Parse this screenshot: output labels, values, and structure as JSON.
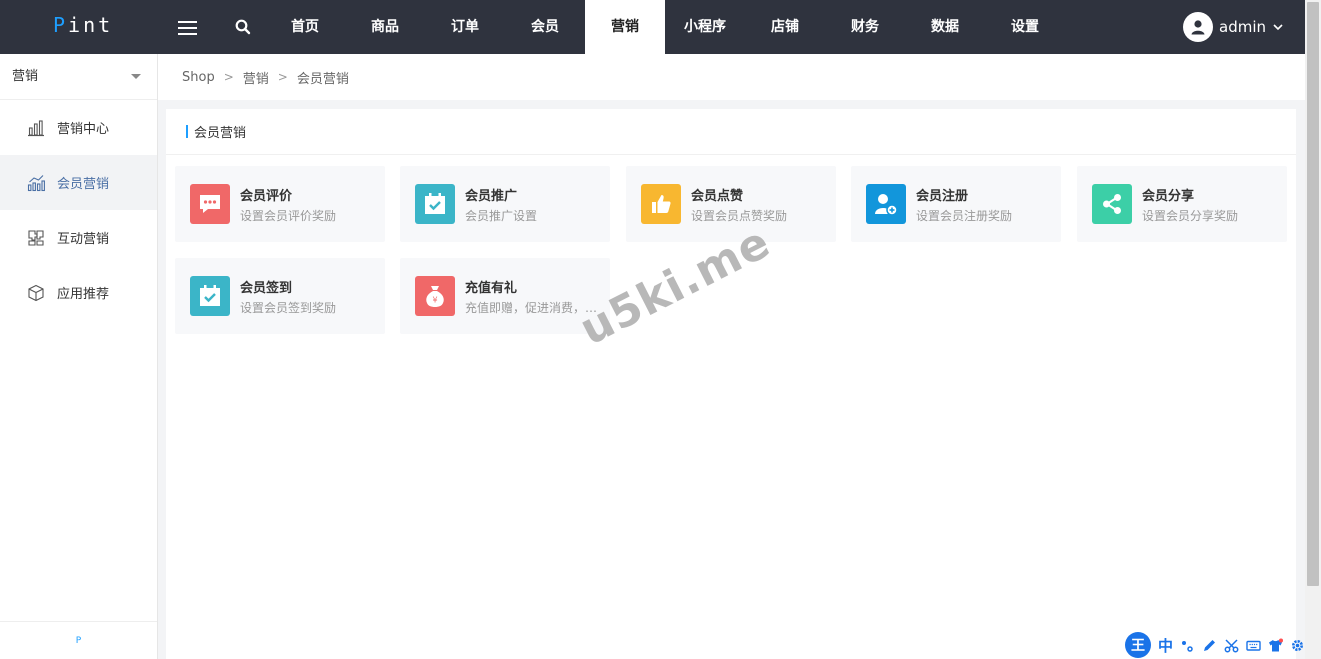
{
  "header": {
    "logo_prefix": "P",
    "logo_rest": "int",
    "nav": [
      {
        "label": "首页"
      },
      {
        "label": "商品"
      },
      {
        "label": "订单"
      },
      {
        "label": "会员"
      },
      {
        "label": "营销"
      },
      {
        "label": "小程序"
      },
      {
        "label": "店铺"
      },
      {
        "label": "财务"
      },
      {
        "label": "数据"
      },
      {
        "label": "设置"
      }
    ],
    "active_nav": "营销",
    "user_name": "admin"
  },
  "sidebar": {
    "section": "营销",
    "items": [
      {
        "label": "营销中心",
        "icon": "bar-chart-icon"
      },
      {
        "label": "会员营销",
        "icon": "line-chart-icon"
      },
      {
        "label": "互动营销",
        "icon": "puzzle-icon"
      },
      {
        "label": "应用推荐",
        "icon": "cube-icon"
      }
    ],
    "active_item": "会员营销",
    "footer": "P"
  },
  "breadcrumb": [
    "Shop",
    "营销",
    "会员营销"
  ],
  "panel": {
    "title": "会员营销",
    "tiles": [
      {
        "title": "会员评价",
        "desc": "设置会员评价奖励",
        "icon": "comment-icon",
        "color": "#f06868"
      },
      {
        "title": "会员推广",
        "desc": "会员推广设置",
        "icon": "calendar-check-icon",
        "color": "#3bb5c8"
      },
      {
        "title": "会员点赞",
        "desc": "设置会员点赞奖励",
        "icon": "thumbs-up-icon",
        "color": "#f8b730"
      },
      {
        "title": "会员注册",
        "desc": "设置会员注册奖励",
        "icon": "user-add-icon",
        "color": "#1296db"
      },
      {
        "title": "会员分享",
        "desc": "设置会员分享奖励",
        "icon": "share-icon",
        "color": "#3ccfa7"
      },
      {
        "title": "会员签到",
        "desc": "设置会员签到奖励",
        "icon": "calendar-check-icon",
        "color": "#3bb5c8"
      },
      {
        "title": "充值有礼",
        "desc": "充值即赠，促进消费，提升会员粘性",
        "icon": "money-bag-icon",
        "color": "#f06868"
      }
    ]
  },
  "watermark": "u5ki.me",
  "ime": {
    "logo": "王",
    "lang": "中"
  }
}
